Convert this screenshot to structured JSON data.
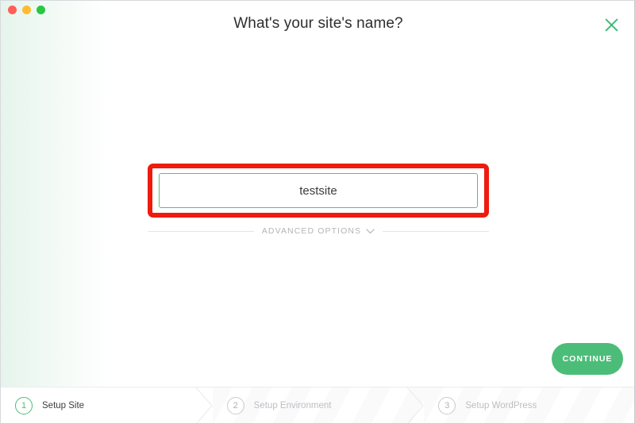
{
  "window": {
    "traffic_lights": [
      {
        "name": "close",
        "color": "#ff5f57"
      },
      {
        "name": "minimize",
        "color": "#febc2e"
      },
      {
        "name": "maximize",
        "color": "#28c840"
      }
    ]
  },
  "header": {
    "title": "What's your site's name?",
    "close_icon": "close-x-icon"
  },
  "form": {
    "site_name_value": "testsite",
    "site_name_placeholder": "",
    "annotation_color": "#ee1b0f",
    "input_border_color": "#56bf7f"
  },
  "advanced": {
    "label": "ADVANCED OPTIONS",
    "chevron_icon": "chevron-down-icon"
  },
  "actions": {
    "continue_label": "CONTINUE",
    "continue_color": "#4cbd79"
  },
  "steps": [
    {
      "number": "1",
      "label": "Setup Site",
      "active": true
    },
    {
      "number": "2",
      "label": "Setup Environment",
      "active": false
    },
    {
      "number": "3",
      "label": "Setup WordPress",
      "active": false
    }
  ]
}
